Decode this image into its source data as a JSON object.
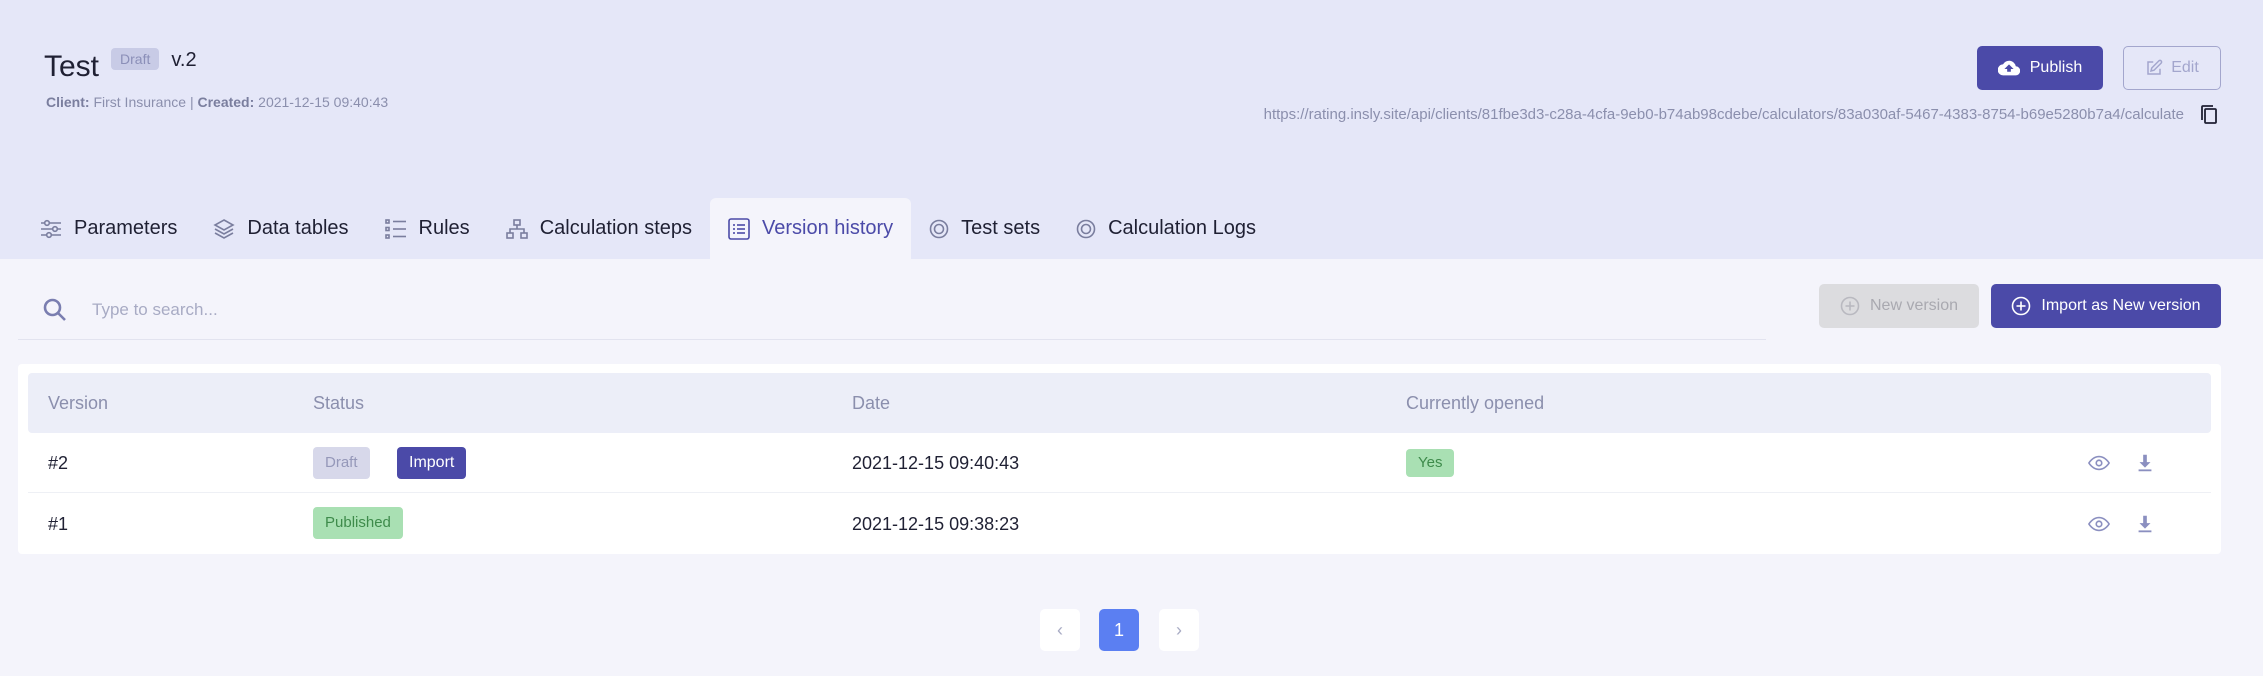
{
  "header": {
    "title": "Test",
    "status_badge": "Draft",
    "version": "v.2",
    "client_label": "Client:",
    "client_value": "First Insurance",
    "separator": "|",
    "created_label": "Created:",
    "created_value": "2021-12-15 09:40:43",
    "publish_label": "Publish",
    "edit_label": "Edit",
    "api_url": "https://rating.insly.site/api/clients/81fbe3d3-c28a-4cfa-9eb0-b74ab98cdebe/calculators/83a030af-5467-4383-8754-b69e5280b7a4/calculate"
  },
  "tabs": [
    {
      "label": "Parameters",
      "icon": "sliders-icon"
    },
    {
      "label": "Data tables",
      "icon": "layers-icon"
    },
    {
      "label": "Rules",
      "icon": "list-icon"
    },
    {
      "label": "Calculation steps",
      "icon": "sitemap-icon"
    },
    {
      "label": "Version history",
      "icon": "table-list-icon",
      "active": true
    },
    {
      "label": "Test sets",
      "icon": "target-icon"
    },
    {
      "label": "Calculation Logs",
      "icon": "target-icon"
    }
  ],
  "toolbar": {
    "search_placeholder": "Type to search...",
    "new_version_label": "New version",
    "import_new_label": "Import as New version"
  },
  "table": {
    "columns": [
      "Version",
      "Status",
      "Date",
      "Currently opened"
    ],
    "rows": [
      {
        "version": "#2",
        "status": "Draft",
        "import_label": "Import",
        "date": "2021-12-15 09:40:43",
        "opened": "Yes"
      },
      {
        "version": "#1",
        "status": "Published",
        "date": "2021-12-15 09:38:23",
        "opened": ""
      }
    ]
  },
  "pagination": {
    "prev": "‹",
    "current": "1",
    "next": "›"
  },
  "colors": {
    "primary": "#4b4aa8",
    "header_bg": "#e5e7f8",
    "page_bg": "#f4f4fb",
    "success_bg": "#a9e0b3",
    "pager_active": "#5b7ff2"
  }
}
